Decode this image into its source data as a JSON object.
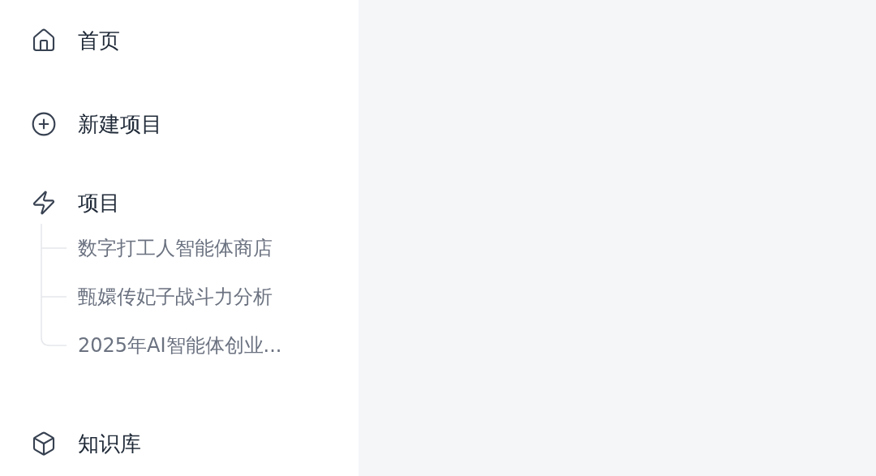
{
  "sidebar": {
    "items": [
      {
        "kind": "home",
        "label": "首页"
      },
      {
        "kind": "new",
        "label": "新建项目"
      },
      {
        "kind": "projects",
        "label": "项目",
        "children": [
          {
            "label": "数字打工人智能体商店"
          },
          {
            "label": "甄嬛传妃子战斗力分析"
          },
          {
            "label": "2025年AI智能体创业..."
          }
        ]
      },
      {
        "kind": "knowledge",
        "label": "知识库"
      }
    ]
  }
}
